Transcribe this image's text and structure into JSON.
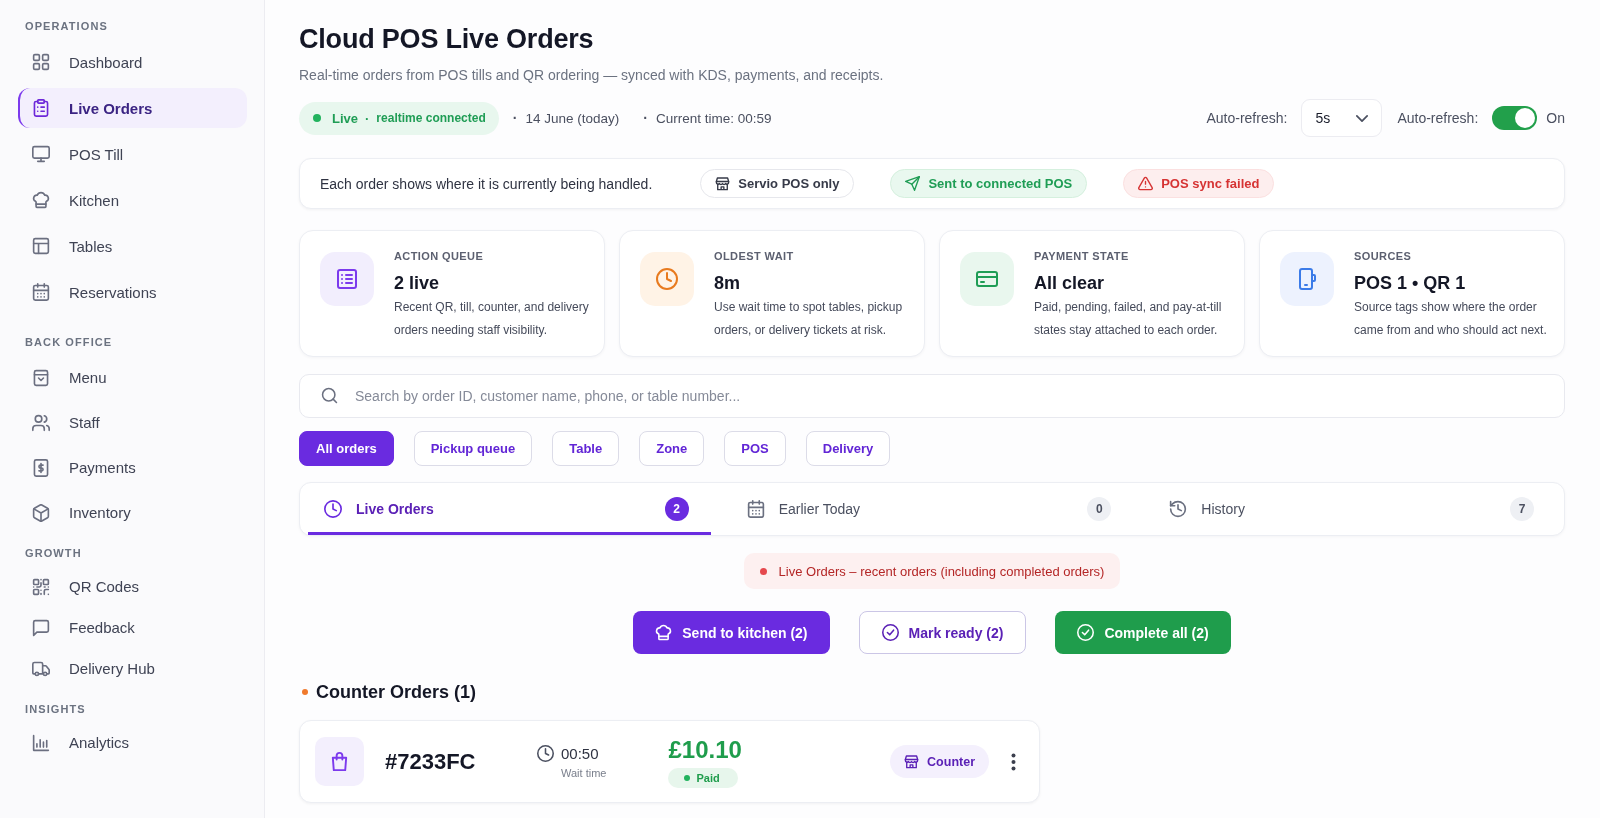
{
  "sidebar": {
    "sections": [
      {
        "heading": "OPERATIONS",
        "items": [
          {
            "label": "Dashboard",
            "selected": false
          },
          {
            "label": "Live Orders",
            "selected": true
          },
          {
            "label": "POS Till",
            "selected": false
          },
          {
            "label": "Kitchen",
            "selected": false
          },
          {
            "label": "Tables",
            "selected": false
          },
          {
            "label": "Reservations",
            "selected": false
          }
        ]
      },
      {
        "heading": "BACK OFFICE",
        "items": [
          {
            "label": "Menu",
            "selected": false
          },
          {
            "label": "Staff",
            "selected": false
          },
          {
            "label": "Payments",
            "selected": false
          },
          {
            "label": "Inventory",
            "selected": false
          }
        ]
      },
      {
        "heading": "GROWTH",
        "items": [
          {
            "label": "QR Codes",
            "selected": false
          },
          {
            "label": "Feedback",
            "selected": false
          },
          {
            "label": "Delivery Hub",
            "selected": false
          }
        ]
      },
      {
        "heading": "INSIGHTS",
        "items": [
          {
            "label": "Analytics",
            "selected": false
          }
        ]
      }
    ]
  },
  "header": {
    "title": "Cloud POS Live Orders",
    "subtitle": "Real-time orders from POS tills and QR ordering — synced with KDS, payments, and receipts.",
    "status": {
      "label": "Live",
      "separator": "·",
      "detail": "realtime connected"
    },
    "meta": [
      {
        "separator": "·",
        "text": "14 June (today)"
      },
      {
        "separator": "·",
        "text": "Current time: 00:59"
      }
    ],
    "refresh": {
      "interval_label": "Auto-refresh:",
      "interval": "5s",
      "toggle_label": "Auto-refresh:",
      "on": true,
      "state": "On"
    }
  },
  "routing": {
    "text": "Each order shows where it is currently being handled.",
    "legend": [
      {
        "label": "Servio POS only",
        "kind": "local"
      },
      {
        "label": "Sent to connected POS",
        "kind": "sent"
      },
      {
        "label": "POS sync failed",
        "kind": "failed"
      }
    ]
  },
  "stats": [
    {
      "kind": "queue",
      "label": "ACTION QUEUE",
      "value": "2 live",
      "description": "Recent QR, till, counter, and delivery orders needing staff visibility."
    },
    {
      "kind": "wait",
      "label": "OLDEST WAIT",
      "value": "8m",
      "description": "Use wait time to spot tables, pickup orders, or delivery tickets at risk."
    },
    {
      "kind": "payment",
      "label": "PAYMENT STATE",
      "value": "All clear",
      "description": "Paid, pending, failed, and pay-at-till states stay attached to each order."
    },
    {
      "kind": "sources",
      "label": "SOURCES",
      "value": "POS 1 • QR 1",
      "description": "Source tags show where the order came from and who should act next."
    }
  ],
  "search": {
    "placeholder": "Search by order ID, customer name, phone, or table number..."
  },
  "filters": [
    {
      "label": "All orders",
      "selected": true
    },
    {
      "label": "Pickup queue",
      "selected": false
    },
    {
      "label": "Table",
      "selected": false
    },
    {
      "label": "Zone",
      "selected": false
    },
    {
      "label": "POS",
      "selected": false
    },
    {
      "label": "Delivery",
      "selected": false
    }
  ],
  "tabs": [
    {
      "label": "Live Orders",
      "count": "2",
      "selected": true
    },
    {
      "label": "Earlier Today",
      "count": "0",
      "selected": false
    },
    {
      "label": "History",
      "count": "7",
      "selected": false
    }
  ],
  "notice": {
    "text": "Live Orders – recent orders (including completed orders)"
  },
  "actions": [
    {
      "kind": "kitchen",
      "label": "Send to kitchen (2)"
    },
    {
      "kind": "ready",
      "label": "Mark ready (2)"
    },
    {
      "kind": "complete",
      "label": "Complete all (2)"
    }
  ],
  "groups": [
    {
      "title": "Counter Orders (1)",
      "color": "#f07a2c",
      "orders": [
        {
          "id": "#7233FC",
          "wait": "00:50",
          "wait_label": "Wait time",
          "total": "£10.10",
          "payment": {
            "kind": "paid",
            "label": "Paid"
          },
          "source": "Counter"
        }
      ]
    }
  ]
}
